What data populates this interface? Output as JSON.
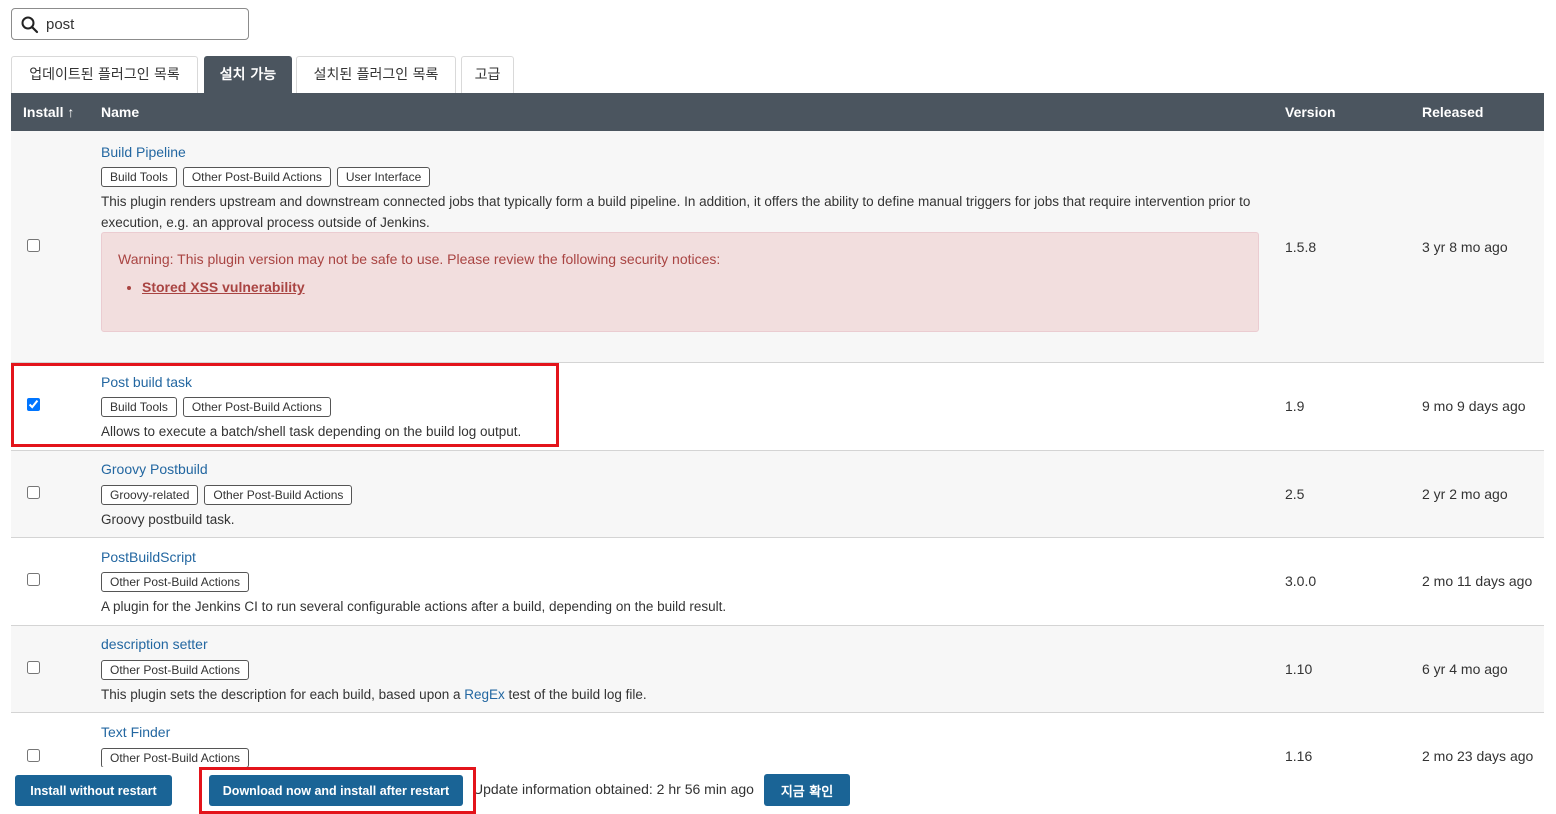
{
  "search": {
    "value": "post",
    "icon": "search-icon"
  },
  "tabs": [
    {
      "label": "업데이트된 플러그인 목록",
      "active": false
    },
    {
      "label": "설치 가능",
      "active": true
    },
    {
      "label": "설치된 플러그인 목록",
      "active": false
    },
    {
      "label": "고급",
      "active": false
    }
  ],
  "table": {
    "headers": {
      "install": "Install ↑",
      "name": "Name",
      "version": "Version",
      "released": "Released"
    },
    "rows": [
      {
        "name": "Build Pipeline",
        "tags": [
          "Build Tools",
          "Other Post-Build Actions",
          "User Interface"
        ],
        "description": "This plugin renders upstream and downstream connected jobs that typically form a build pipeline. In addition, it offers the ability to define manual triggers for jobs that require intervention prior to execution, e.g. an approval process outside of Jenkins.",
        "version": "1.5.8",
        "released": "3 yr 8 mo ago",
        "checked": false,
        "warning": {
          "text": "Warning: This plugin version may not be safe to use. Please review the following security notices:",
          "link": "Stored XSS vulnerability"
        }
      },
      {
        "name": "Post build task",
        "tags": [
          "Build Tools",
          "Other Post-Build Actions"
        ],
        "description": "Allows to execute a batch/shell task depending on the build log output.",
        "version": "1.9",
        "released": "9 mo 9 days ago",
        "checked": true
      },
      {
        "name": "Groovy Postbuild",
        "tags": [
          "Groovy-related",
          "Other Post-Build Actions"
        ],
        "description": "Groovy postbuild task.",
        "version": "2.5",
        "released": "2 yr 2 mo ago",
        "checked": false
      },
      {
        "name": "PostBuildScript",
        "tags": [
          "Other Post-Build Actions"
        ],
        "description": "A plugin for the Jenkins CI to run several configurable actions after a build, depending on the build result.",
        "version": "3.0.0",
        "released": "2 mo 11 days ago",
        "checked": false
      },
      {
        "name": "description setter",
        "tags": [
          "Other Post-Build Actions"
        ],
        "description_pre": "This plugin sets the description for each build, based upon a ",
        "description_link": "RegEx",
        "description_post": " test of the build log file.",
        "version": "1.10",
        "released": "6 yr 4 mo ago",
        "checked": false
      },
      {
        "name": "Text Finder",
        "tags": [
          "Other Post-Build Actions"
        ],
        "version": "1.16",
        "released": "2 mo 23 days ago",
        "checked": false
      }
    ]
  },
  "footer": {
    "install_without_restart": "Install without restart",
    "download_now": "Download now and install after restart",
    "update_info": "Update information obtained: 2 hr 56 min ago",
    "check_now": "지금 확인"
  },
  "colors": {
    "header_bg": "#4b555f",
    "link": "#2367a1",
    "button": "#1a6496",
    "highlight": "#e3141b",
    "warning_bg": "#f2dede"
  }
}
